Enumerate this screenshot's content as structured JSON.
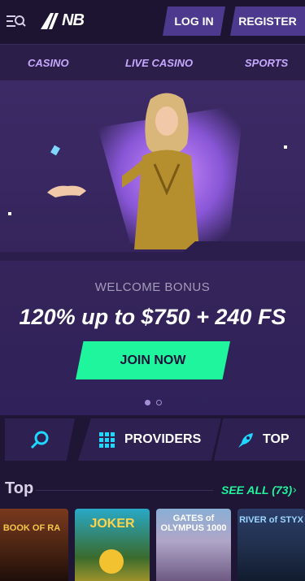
{
  "header": {
    "logo": "NB",
    "login_label": "LOG IN",
    "register_label": "REGISTER"
  },
  "nav": {
    "items": [
      {
        "label": "CASINO"
      },
      {
        "label": "LIVE CASINO"
      },
      {
        "label": "SPORTS"
      }
    ]
  },
  "hero": {
    "welcome": "WELCOME BONUS",
    "bonus": "120% up to $750 + 240 FS",
    "cta_label": "JOIN NOW",
    "slides_total": 2,
    "slide_active": 1
  },
  "quick_bar": {
    "providers_label": "PROVIDERS",
    "top_label": "TOP"
  },
  "top_section": {
    "title": "Top",
    "see_all_label": "SEE ALL (73)"
  },
  "games": [
    {
      "title": "BOOK OF RA"
    },
    {
      "title": "JOKER"
    },
    {
      "title": "GATES of OLYMPUS 1000"
    },
    {
      "title": "RIVER of STYX"
    }
  ],
  "colors": {
    "background": "#1f1534",
    "accent": "#1ff59c",
    "button": "#4d3a8e",
    "nav_text": "#c6a9ff"
  }
}
